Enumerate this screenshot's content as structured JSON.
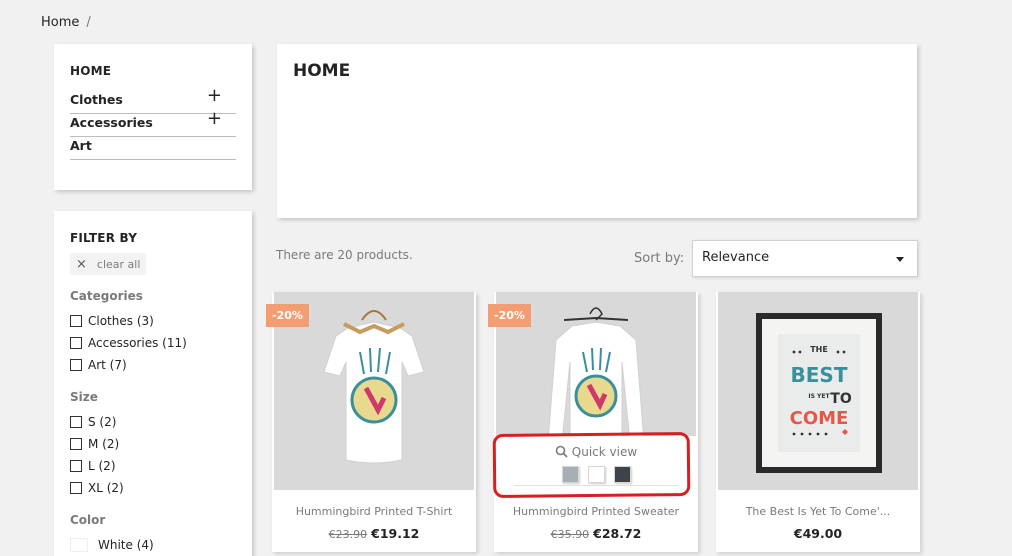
{
  "breadcrumb": {
    "home": "Home",
    "separator": "/"
  },
  "categories": {
    "title": "HOME",
    "items": [
      {
        "label": "Clothes",
        "expand": "+"
      },
      {
        "label": "Accessories",
        "expand": "+"
      },
      {
        "label": "Art"
      }
    ]
  },
  "filters": {
    "title": "FILTER BY",
    "clear_all": "clear all",
    "clear_icon": "×",
    "categories": {
      "title": "Categories",
      "options": [
        "Clothes (3)",
        "Accessories (11)",
        "Art (7)"
      ]
    },
    "size": {
      "title": "Size",
      "options": [
        "S (2)",
        "M (2)",
        "L (2)",
        "XL (2)"
      ]
    },
    "color": {
      "title": "Color",
      "options": [
        "White (4)"
      ]
    }
  },
  "header": {
    "title": "HOME"
  },
  "listing": {
    "count": "There are 20 products.",
    "sort_label": "Sort by:",
    "sort_value": "Relevance"
  },
  "products": [
    {
      "badge": "-20%",
      "name": "Hummingbird Printed T-Shirt",
      "old_price": "€23.90",
      "price": "€19.12"
    },
    {
      "badge": "-20%",
      "name": "Hummingbird Printed Sweater",
      "old_price": "€35.90",
      "price": "€28.72",
      "quick_view": "Quick view",
      "swatches": [
        "#a7aeb6",
        "#ffffff",
        "#3e4249"
      ]
    },
    {
      "name": "The Best Is Yet To Come'...",
      "price": "€49.00",
      "poster": {
        "line1": "THE",
        "line2": "BEST",
        "line3": "IS YET",
        "line4": "TO",
        "line5": "COME"
      }
    }
  ],
  "colors": {
    "accent_badge": "#f39d72",
    "annotation": "#d81f1f",
    "poster_teal": "#3a8f9c",
    "poster_red": "#e4574a"
  }
}
